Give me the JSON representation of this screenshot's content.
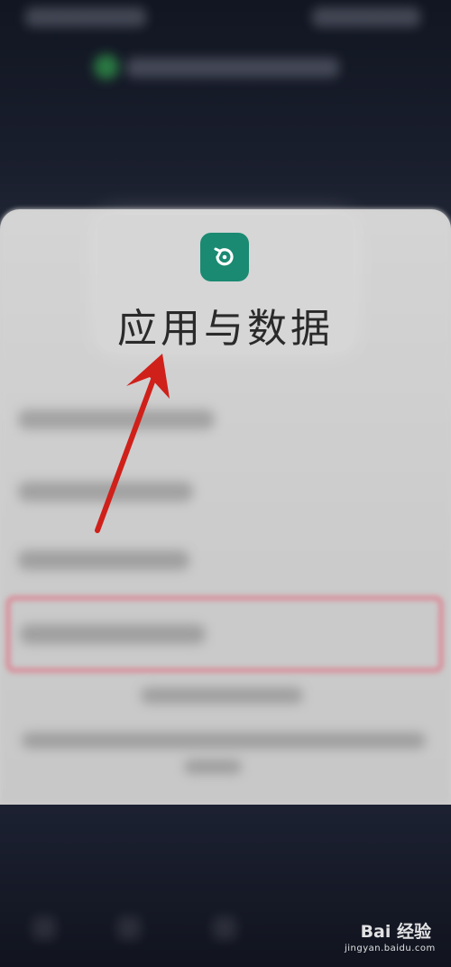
{
  "app": {
    "title": "应用与数据",
    "icon": "restore-icon",
    "icon_color": "#1a8a72"
  },
  "annotation": {
    "arrow_color": "#d0201a",
    "highlight_color": "#e06478"
  },
  "watermark": {
    "main": "Bai 经验",
    "sub": "jingyan.baidu.com"
  }
}
